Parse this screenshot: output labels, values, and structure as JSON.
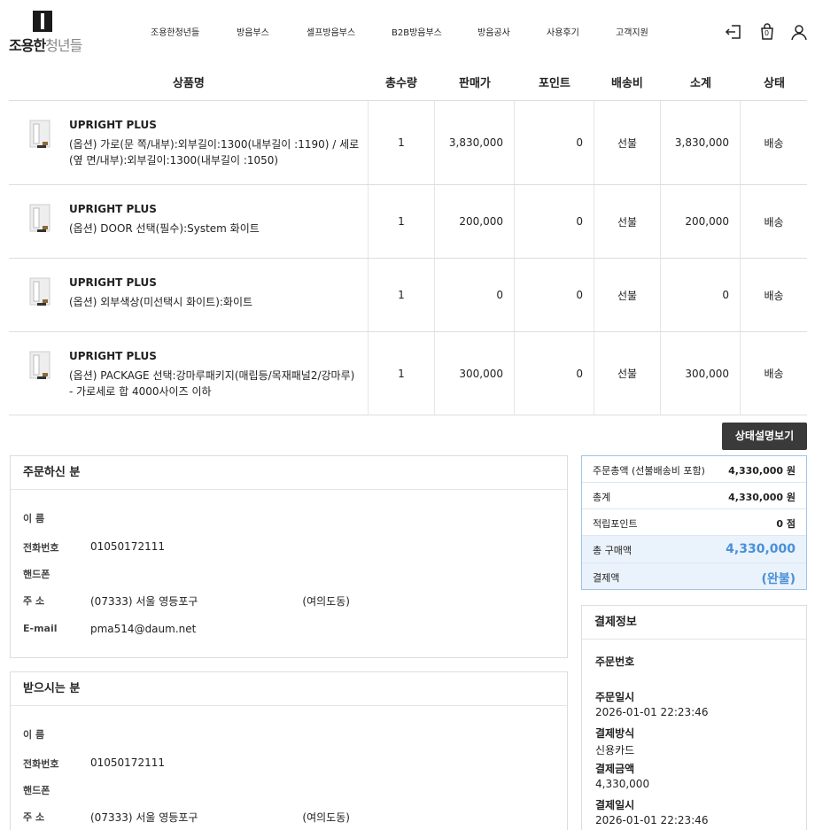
{
  "brand": {
    "logo_text_bold": "조용한",
    "logo_text_light": "청년들"
  },
  "nav": [
    "조용한청년들",
    "방음부스",
    "셀프방음부스",
    "B2B방음부스",
    "방음공사",
    "사용후기",
    "고객지원"
  ],
  "cart_count": "0",
  "table": {
    "headers": [
      "상품명",
      "총수량",
      "판매가",
      "포인트",
      "배송비",
      "소계",
      "상태"
    ],
    "rows": [
      {
        "name": "UPRIGHT PLUS",
        "option": "(옵션) 가로(문 쪽/내부):외부길이:1300(내부길이 :1190) / 세로(옆 면/내부):외부길이:1300(내부길이 :1050)",
        "qty": "1",
        "price": "3,830,000",
        "point": "0",
        "shipping": "선불",
        "subtotal": "3,830,000",
        "status": "배송"
      },
      {
        "name": "UPRIGHT PLUS",
        "option": "(옵션) DOOR 선택(필수):System 화이트",
        "qty": "1",
        "price": "200,000",
        "point": "0",
        "shipping": "선불",
        "subtotal": "200,000",
        "status": "배송"
      },
      {
        "name": "UPRIGHT PLUS",
        "option": "(옵션) 외부색상(미선택시 화이트):화이트",
        "qty": "1",
        "price": "0",
        "point": "0",
        "shipping": "선불",
        "subtotal": "0",
        "status": "배송"
      },
      {
        "name": "UPRIGHT PLUS",
        "option": "(옵션) PACKAGE 선택:강마루패키지(매립등/목재패널2/강마루) - 가로세로 합 4000사이즈 이하",
        "qty": "1",
        "price": "300,000",
        "point": "0",
        "shipping": "선불",
        "subtotal": "300,000",
        "status": "배송"
      }
    ]
  },
  "status_button": "상태설명보기",
  "orderer": {
    "title": "주문하신 분",
    "labels": {
      "name": "이 름",
      "phone": "전화번호",
      "mobile": "핸드폰",
      "address": "주 소",
      "email": "E-mail"
    },
    "values": {
      "name": "",
      "phone": "01050172111",
      "mobile": "",
      "address_prefix": "(07333) 서울 영등포구",
      "address_suffix": "(여의도동)",
      "email": "pma514@daum.net"
    }
  },
  "receiver": {
    "title": "받으시는 분",
    "labels": {
      "name": "이 름",
      "phone": "전화번호",
      "mobile": "핸드폰",
      "address": "주 소"
    },
    "values": {
      "phone": "01050172111",
      "address_prefix": "(07333) 서울 영등포구",
      "address_suffix": "(여의도동)"
    }
  },
  "summary": {
    "total_label": "주문총액 (선불배송비 포함)",
    "total_value": "4,330,000 원",
    "sum_label": "총계",
    "sum_value": "4,330,000 원",
    "point_label": "적립포인트",
    "point_value": "0 점",
    "purchase_label": "총 구매액",
    "purchase_value": "4,330,000",
    "paid_label": "결제액",
    "paid_value": "(완불)"
  },
  "payment": {
    "title": "결제정보",
    "order_no_label": "주문번호",
    "order_no_value": "",
    "order_date_label": "주문일시",
    "order_date_value": "2026-01-01 22:23:46",
    "method_label": "결제방식",
    "method_value": "신용카드",
    "amount_label": "결제금액",
    "amount_value": "4,330,000",
    "paid_date_label": "결제일시",
    "paid_date_value": "2026-01-01 22:23:46"
  },
  "colors": {
    "accent": "#4a90d9",
    "button": "#3a3a3a",
    "summary_border": "#9fc3e8"
  }
}
